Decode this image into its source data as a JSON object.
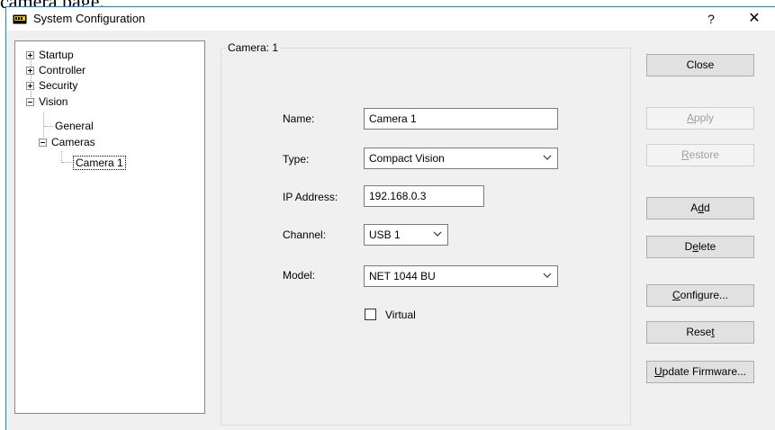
{
  "overlay_text": "camera page.",
  "window": {
    "title": "System Configuration",
    "help_label": "?",
    "close_label": "✕"
  },
  "tree": {
    "items": [
      {
        "label": "Startup",
        "expander": "+"
      },
      {
        "label": "Controller",
        "expander": "+"
      },
      {
        "label": "Security",
        "expander": "+"
      },
      {
        "label": "Vision",
        "expander": "−"
      },
      {
        "label": "General"
      },
      {
        "label": "Cameras",
        "expander": "−"
      },
      {
        "label": "Camera 1"
      }
    ]
  },
  "group": {
    "label": "Camera: 1"
  },
  "form": {
    "name_label": "Name:",
    "name_value": "Camera 1",
    "type_label": "Type:",
    "type_value": "Compact Vision",
    "ip_label": "IP Address:",
    "ip_value": "192.168.0.3",
    "channel_label": "Channel:",
    "channel_value": "USB 1",
    "model_label": "Model:",
    "model_value": "NET 1044 BU",
    "virtual_label": "Virtual",
    "virtual_checked": false
  },
  "buttons": {
    "close": {
      "pre": "Close",
      "u": "",
      "post": ""
    },
    "apply": {
      "pre": "",
      "u": "A",
      "post": "pply"
    },
    "restore": {
      "pre": "",
      "u": "R",
      "post": "estore"
    },
    "add": {
      "pre": "A",
      "u": "d",
      "post": "d"
    },
    "delete": {
      "pre": "D",
      "u": "e",
      "post": "lete"
    },
    "configure": {
      "pre": "",
      "u": "C",
      "post": "onfigure..."
    },
    "reset": {
      "pre": "Rese",
      "u": "t",
      "post": ""
    },
    "update_firmware": {
      "pre": "",
      "u": "U",
      "post": "pdate Firmware..."
    }
  }
}
